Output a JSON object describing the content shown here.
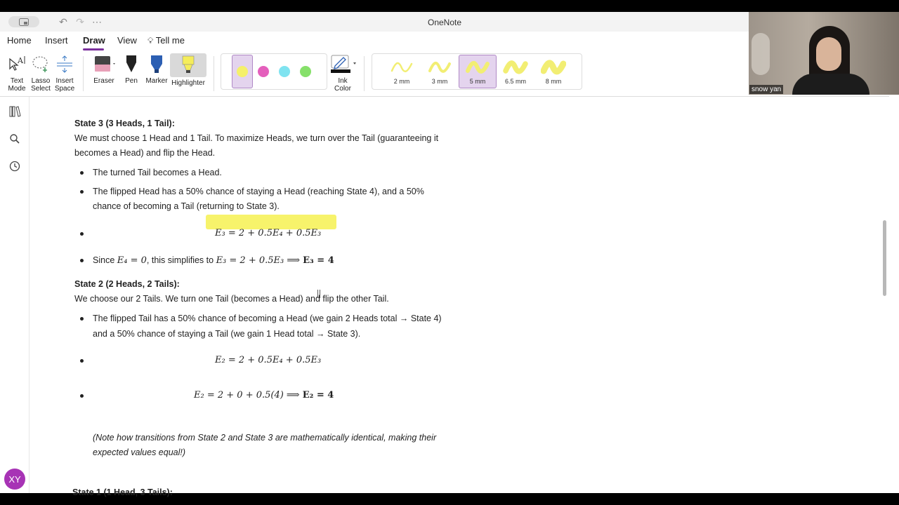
{
  "app": {
    "title": "OneNote"
  },
  "menu": {
    "items": [
      "Home",
      "Insert",
      "Draw",
      "View",
      "Tell me"
    ],
    "active": "Draw"
  },
  "ribbon": {
    "text_mode": [
      "Text",
      "Mode"
    ],
    "lasso": [
      "Lasso",
      "Select"
    ],
    "insert_space": [
      "Insert",
      "Space"
    ],
    "eraser": "Eraser",
    "pen": "Pen",
    "marker": "Marker",
    "highlighter": "Highlighter",
    "ink_color": [
      "Ink",
      "Color"
    ],
    "swatch_colors": [
      "#f5f06b",
      "#e45fbc",
      "#7fe3f0",
      "#86e06a"
    ],
    "sizes": [
      "2 mm",
      "3 mm",
      "5 mm",
      "6.5 mm",
      "8 mm"
    ],
    "selected_size": "5 mm",
    "highlight_color": "#f7f36b"
  },
  "page": {
    "state3_heading": "State 3 (3 Heads, 1 Tail):",
    "state3_intro_1": "We must choose 1 Head and 1 Tail. To maximize Heads, we turn over the Tail (guaranteeing it",
    "state3_intro_2": "becomes a Head) and flip the Head.",
    "state3_b1": "The turned Tail becomes a Head.",
    "state3_b2_1": "The flipped Head has a 50% chance of staying a Head (reaching State 4), and a 50%",
    "state3_b2_2": "chance of becoming a Tail (returning to State 3).",
    "state3_eq": "E₃ = 2 + 0.5E₄ + 0.5E₃",
    "state3_since_pre": "Since",
    "state3_since_e4": "E₄ = 0",
    "state3_since_mid": ", this simplifies to",
    "state3_since_eq": "E₃ = 2 + 0.5E₃  ⟹ ",
    "state3_since_res": "E₃ = 4",
    "state2_heading": "State 2 (2 Heads, 2 Tails):",
    "state2_intro": "We choose our 2 Tails. We turn one Tail (becomes a Head) and flip the other Tail.",
    "state2_b1_1": "The flipped Tail has a 50% chance of becoming a Head (we gain 2 Heads total → State 4)",
    "state2_b1_2": "and a 50% chance of staying a Tail (we gain 1 Head total → State 3).",
    "state2_eq1": "E₂ = 2 + 0.5E₄ + 0.5E₃",
    "state2_eq2": "E₂ = 2 + 0 + 0.5(4)  ⟹ ",
    "state2_eq2_res": "E₂ = 4",
    "note_1": "(Note how transitions from State 2 and State 3 are mathematically identical, making their",
    "note_2": "expected values equal!)",
    "state1_heading": "State 1 (1 Head, 3 Tails):"
  },
  "user": {
    "initials": "XY"
  },
  "webcam": {
    "name": "snow yan"
  }
}
